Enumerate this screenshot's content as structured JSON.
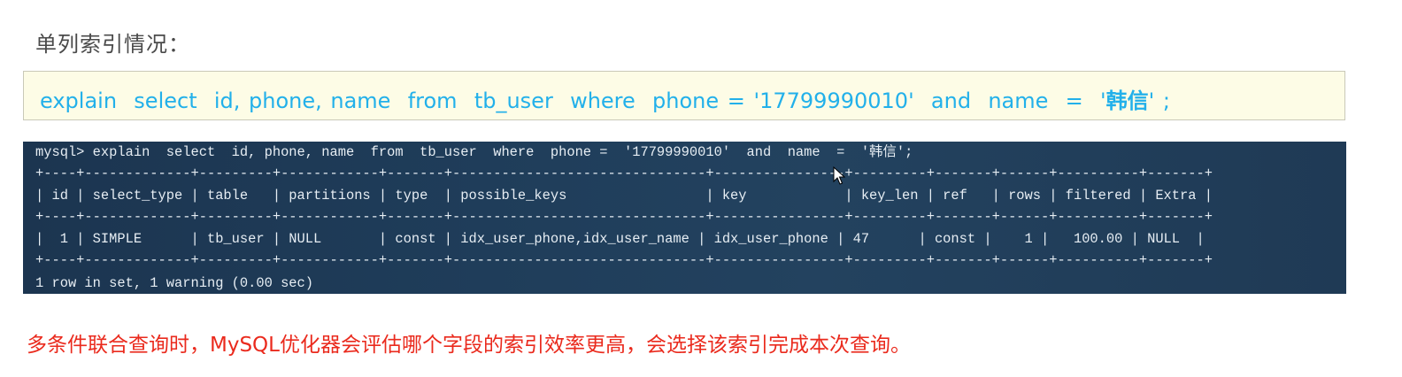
{
  "heading": "单列索引情况：",
  "sql_box": {
    "before": "explain  select  id, phone, name  from  tb_user  where  phone = '17799990010'  and  name  =  '",
    "highlight": "韩信",
    "after": "' ;"
  },
  "terminal": {
    "command": "mysql> explain  select  id, phone, name  from  tb_user  where  phone =  '17799990010'  and  name  =  '韩信';",
    "separator": "+----+-------------+---------+------------+-------+-------------------------------+----------------+---------+-------+------+----------+-------+",
    "header_row": "| id | select_type | table   | partitions | type  | possible_keys                 | key            | key_len | ref   | rows | filtered | Extra |",
    "data_row": "|  1 | SIMPLE      | tb_user | NULL       | const | idx_user_phone,idx_user_name | idx_user_phone | 47      | const |    1 |   100.00 | NULL  |",
    "status": "1 row in set, 1 warning (0.00 sec)"
  },
  "footer_note": "多条件联合查询时，MySQL优化器会评估哪个字段的索引效率更高，会选择该索引完成本次查询。"
}
